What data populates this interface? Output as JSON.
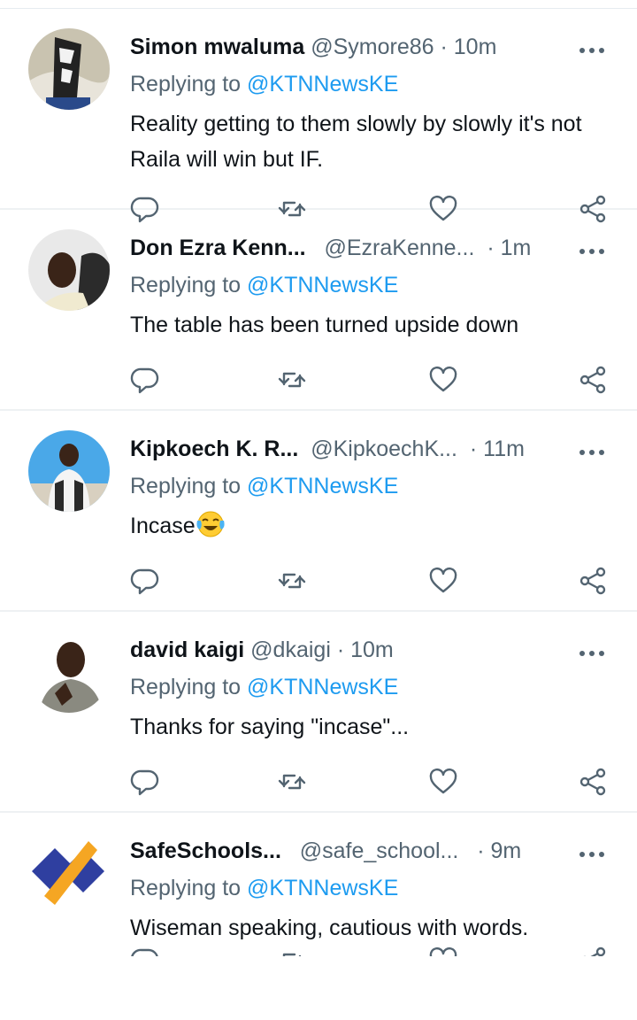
{
  "tweets": [
    {
      "name": "Simon mwaluma",
      "handle": "@Symore86",
      "separator": "·",
      "time": "10m",
      "replying_prefix": "Replying to",
      "replying_to": "@KTNNewsKE",
      "text": "Reality getting to them slowly by slowly it's not Raila will win but IF."
    },
    {
      "name": "Don Ezra Kenn...",
      "handle": "@EzraKenne...",
      "separator": "·",
      "time": "1m",
      "replying_prefix": "Replying to",
      "replying_to": "@KTNNewsKE",
      "text": "The table has been turned upside down"
    },
    {
      "name": "Kipkoech K. R...",
      "handle": "@KipkoechK...",
      "separator": "·",
      "time": "11m",
      "replying_prefix": "Replying to",
      "replying_to": "@KTNNewsKE",
      "text": "Incase"
    },
    {
      "name": "david kaigi",
      "handle": "@dkaigi",
      "separator": "·",
      "time": "10m",
      "replying_prefix": "Replying to",
      "replying_to": "@KTNNewsKE",
      "text": "Thanks for saying \"incase\"..."
    },
    {
      "name": "SafeSchools...",
      "handle": "@safe_school...",
      "separator": "·",
      "time": "9m",
      "replying_prefix": "Replying to",
      "replying_to": "@KTNNewsKE",
      "text": "Wiseman speaking, cautious with words."
    }
  ],
  "icons": {
    "reply": "reply-icon",
    "retweet": "retweet-icon",
    "like": "heart-icon",
    "share": "share-icon",
    "more": "more-icon",
    "emoji": "face-with-tears-of-joy-emoji"
  },
  "colors": {
    "link": "#1d9bf0",
    "secondary_text": "#536471",
    "icon": "#536471",
    "divider": "#eef1f3"
  }
}
